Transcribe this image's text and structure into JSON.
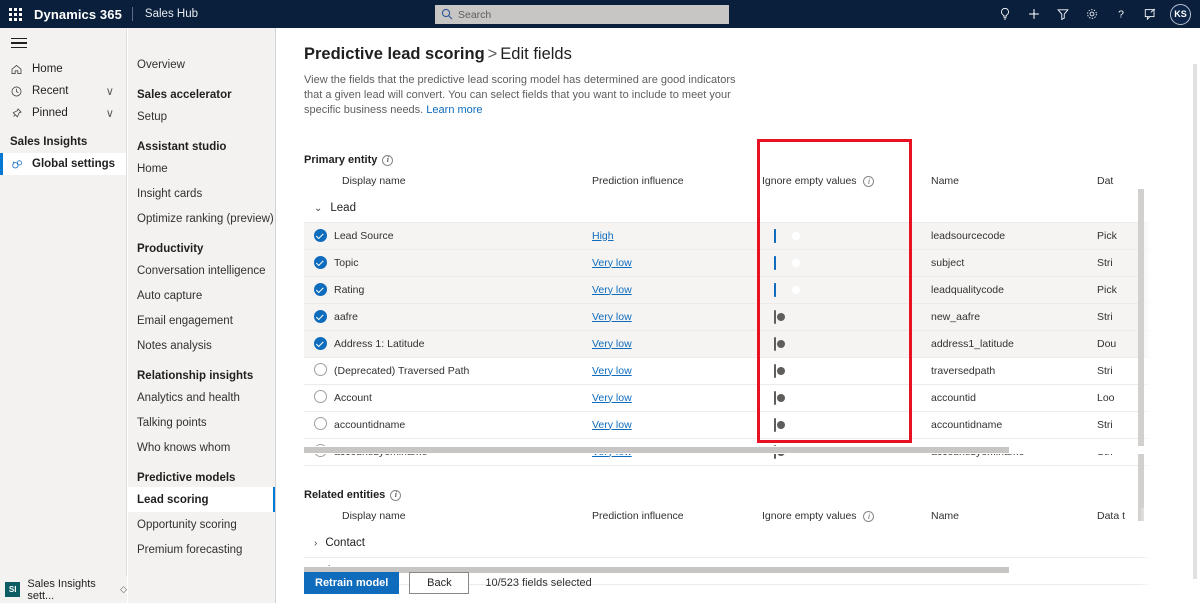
{
  "topbar": {
    "waffle_label": "App launcher",
    "brand": "Dynamics 365",
    "app_name": "Sales Hub",
    "search_placeholder": "Search",
    "search_value": "",
    "icons": [
      "lightbulb-icon",
      "plus-icon",
      "filter-icon",
      "gear-icon",
      "question-icon",
      "feedback-icon"
    ],
    "avatar_initials": "KS"
  },
  "leftrail": {
    "items": [
      {
        "label": "Home",
        "icon": "home-icon",
        "chevron": ""
      },
      {
        "label": "Recent",
        "icon": "clock-icon",
        "chevron": "∨"
      },
      {
        "label": "Pinned",
        "icon": "pin-icon",
        "chevron": "∨"
      }
    ],
    "section_title": "Sales Insights",
    "selected_item": {
      "label": "Global settings",
      "icon": "global-settings-icon"
    },
    "bottom": {
      "badge": "SI",
      "label": "Sales Insights sett...",
      "chevron": "◇"
    }
  },
  "subnav": {
    "overview": "Overview",
    "groups": [
      {
        "header": "",
        "items": [
          "Overview"
        ]
      },
      {
        "header": "Sales accelerator",
        "items": [
          "Setup"
        ]
      },
      {
        "header": "Assistant studio",
        "items": [
          "Home",
          "Insight cards",
          "Optimize ranking (preview)"
        ]
      },
      {
        "header": "Productivity",
        "items": [
          "Conversation intelligence",
          "Auto capture",
          "Email engagement",
          "Notes analysis"
        ]
      },
      {
        "header": "Relationship insights",
        "items": [
          "Analytics and health",
          "Talking points",
          "Who knows whom"
        ]
      },
      {
        "header": "Predictive models",
        "items": [
          "Lead scoring",
          "Opportunity scoring",
          "Premium forecasting"
        ]
      }
    ],
    "active_item": "Lead scoring"
  },
  "page": {
    "breadcrumb_parent": "Predictive lead scoring",
    "breadcrumb_sep": ">",
    "breadcrumb_current": "Edit fields",
    "description": "View the fields that the predictive lead scoring model has determined are good indicators that a given lead will convert. You can select fields that you want to include to meet your specific business needs.",
    "learn_more": "Learn more",
    "primary_entity_label": "Primary entity",
    "related_entities_label": "Related entities"
  },
  "columns": {
    "display_name": "Display name",
    "prediction_influence": "Prediction influence",
    "ignore_empty_values": "Ignore empty values",
    "name": "Name",
    "data_type": "Dat"
  },
  "primary_entity": {
    "group_label": "Lead",
    "group_expanded": true,
    "rows": [
      {
        "checked": true,
        "display_name": "Lead Source",
        "influence": "High",
        "ignore_empty": true,
        "name": "leadsourcecode",
        "data_type": "Pick"
      },
      {
        "checked": true,
        "display_name": "Topic",
        "influence": "Very low",
        "ignore_empty": true,
        "name": "subject",
        "data_type": "Stri"
      },
      {
        "checked": true,
        "display_name": "Rating",
        "influence": "Very low",
        "ignore_empty": true,
        "name": "leadqualitycode",
        "data_type": "Pick"
      },
      {
        "checked": true,
        "display_name": "aafre",
        "influence": "Very low",
        "ignore_empty": false,
        "name": "new_aafre",
        "data_type": "Stri"
      },
      {
        "checked": true,
        "display_name": "Address 1: Latitude",
        "influence": "Very low",
        "ignore_empty": false,
        "name": "address1_latitude",
        "data_type": "Dou"
      },
      {
        "checked": false,
        "display_name": "(Deprecated) Traversed Path",
        "influence": "Very low",
        "ignore_empty": false,
        "name": "traversedpath",
        "data_type": "Stri"
      },
      {
        "checked": false,
        "display_name": "Account",
        "influence": "Very low",
        "ignore_empty": false,
        "name": "accountid",
        "data_type": "Loo"
      },
      {
        "checked": false,
        "display_name": "accountidname",
        "influence": "Very low",
        "ignore_empty": false,
        "name": "accountidname",
        "data_type": "Stri"
      },
      {
        "checked": false,
        "display_name": "accountidyominame",
        "influence": "Very low",
        "ignore_empty": false,
        "name": "accountidyominame",
        "data_type": "Stri"
      }
    ]
  },
  "related_entities": {
    "columns_data_type": "Data t",
    "rows": [
      {
        "label": "Contact",
        "expanded": false
      },
      {
        "label": "Account",
        "expanded": false
      }
    ]
  },
  "footer": {
    "retrain_label": "Retrain model",
    "back_label": "Back",
    "selection_count": "10/523 fields selected"
  },
  "colors": {
    "brand_navy": "#091F3C",
    "accent_blue": "#0f6cbd",
    "annotation_red": "#e81123",
    "rail_gray": "#f3f2f1",
    "si_teal": "#0d5c63"
  }
}
